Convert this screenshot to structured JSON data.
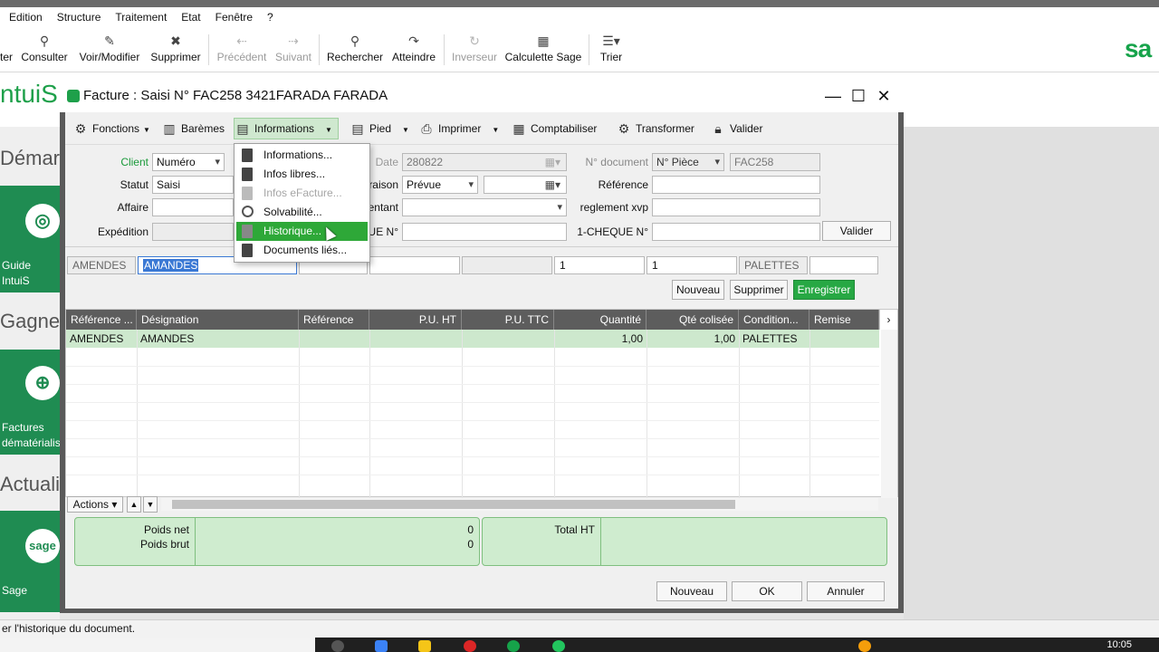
{
  "menubar": [
    "Edition",
    "Structure",
    "Traitement",
    "Etat",
    "Fenêtre",
    "?"
  ],
  "toolbar": {
    "partial_left": "ter",
    "consulter": "Consulter",
    "voir_modifier": "Voir/Modifier",
    "supprimer": "Supprimer",
    "precedent": "Précédent",
    "suivant": "Suivant",
    "rechercher": "Rechercher",
    "atteindre": "Atteindre",
    "inverseur": "Inverseur",
    "calculette": "Calculette Sage",
    "trier": "Trier"
  },
  "app": {
    "logo_text": "sa",
    "title_partial": "ntuiS",
    "section_demarrer": "Démarr",
    "section_gagner": "Gagner",
    "section_actualite": "Actualit",
    "tile_guide": "Guide IntuiS",
    "tile_factures_1": "Factures",
    "tile_factures_2": "dématérialis",
    "tile_sage": "Sage",
    "tile_sage_logo": "sage"
  },
  "dialog": {
    "title": "Facture : Saisi N° FAC258 3421FARADA FARADA",
    "functions": {
      "fonctions": "Fonctions",
      "baremes": "Barèmes",
      "informations": "Informations",
      "pied": "Pied",
      "imprimer": "Imprimer",
      "comptabiliser": "Comptabiliser",
      "transformer": "Transformer",
      "valider": "Valider"
    },
    "form": {
      "client_label": "Client",
      "client_value": "Numéro",
      "statut_label": "Statut",
      "statut_value": "Saisi",
      "affaire_label": "Affaire",
      "expedition_label": "Expédition",
      "date_label": "Date",
      "date_value": "280822",
      "livraison_label": "raison",
      "livraison_value": "Prévue",
      "representant_label": "entant",
      "cheque_label": "UE N°",
      "ndoc_label": "N° document",
      "ndoc_type": "N° Pièce",
      "ndoc_value": "FAC258",
      "reference_label": "Référence",
      "reglement_label": "reglement xvp",
      "cheque1_label": "1-CHEQUE N°",
      "valider_btn": "Valider"
    },
    "line_entry": {
      "ref": "AMENDES",
      "designation": "AMANDES",
      "qty": "1",
      "qty_colisee": "1",
      "conditionnement": "PALETTES"
    },
    "line_buttons": {
      "nouveau": "Nouveau",
      "supprimer": "Supprimer",
      "enregistrer": "Enregistrer"
    },
    "grid": {
      "headers": [
        "Référence ...",
        "Désignation",
        "Référence",
        "P.U. HT",
        "P.U. TTC",
        "Quantité",
        "Qté colisée",
        "Condition...",
        "Remise"
      ],
      "rows": [
        {
          "ref": "AMENDES",
          "designation": "AMANDES",
          "quantite": "1,00",
          "qte_colisee": "1,00",
          "conditionnement": "PALETTES"
        }
      ]
    },
    "actions_label": "Actions",
    "totals": {
      "poids_net_label": "Poids net",
      "poids_brut_label": "Poids brut",
      "poids_net_value": "0",
      "poids_brut_value": "0",
      "total_ht_label": "Total HT"
    },
    "footer_buttons": {
      "nouveau": "Nouveau",
      "ok": "OK",
      "annuler": "Annuler"
    }
  },
  "dropdown": {
    "items": [
      "Informations...",
      "Infos libres...",
      "Infos eFacture...",
      "Solvabilité...",
      "Historique...",
      "Documents liés..."
    ],
    "highlight_color": "#2ea838"
  },
  "statusbar": {
    "text": "er l'historique du document."
  },
  "taskbar": {
    "clock": "10:05"
  }
}
